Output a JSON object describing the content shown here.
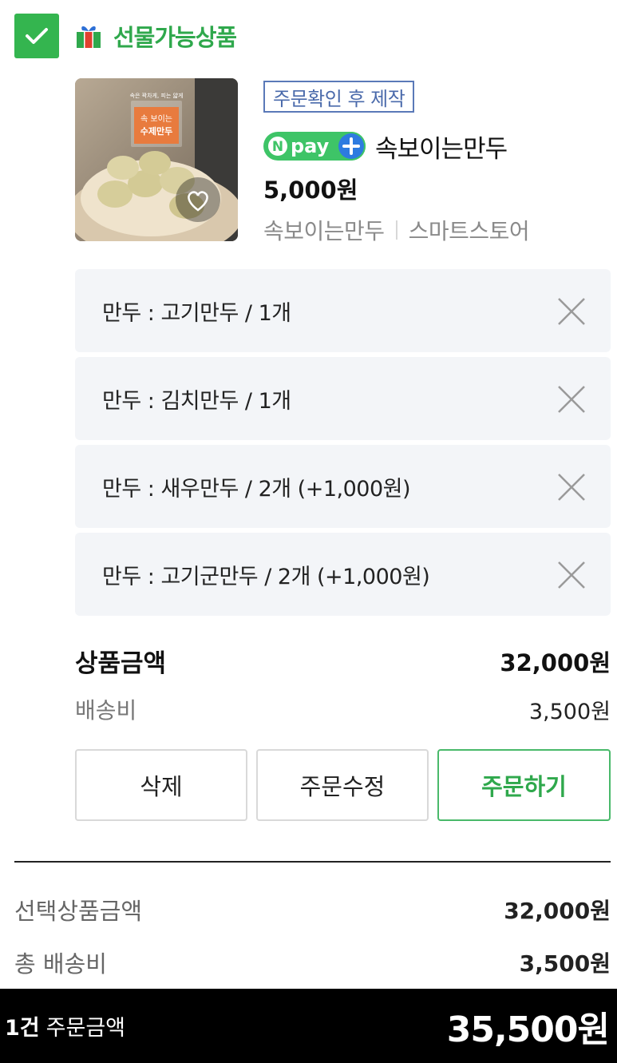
{
  "gift": {
    "checked": true,
    "label": "선물가능상품",
    "accent_color": "#2fa84c"
  },
  "product": {
    "thumbnail": {
      "badge_line1": "속 보이는",
      "badge_line2": "수제만두",
      "small_caption": "속은 꽉차게, 피는 얇게"
    },
    "tag": "주문확인 후 제작",
    "npay_label": "pay",
    "name": "속보이는만두",
    "price": "5,000원",
    "seller": "속보이는만두",
    "store_type": "스마트스토어"
  },
  "options": [
    {
      "text": "만두 : 고기만두 / 1개"
    },
    {
      "text": "만두 : 김치만두 / 1개"
    },
    {
      "text": "만두 : 새우만두 / 2개 (+1,000원)"
    },
    {
      "text": "만두 : 고기군만두 / 2개 (+1,000원)"
    }
  ],
  "summary": {
    "product_amount_label": "상품금액",
    "product_amount_value": "32,000원",
    "shipping_label": "배송비",
    "shipping_value": "3,500원"
  },
  "actions": {
    "delete": "삭제",
    "edit_order": "주문수정",
    "order": "주문하기"
  },
  "totals": {
    "selected_label": "선택상품금액",
    "selected_value": "32,000원",
    "shipping_label": "총 배송비",
    "shipping_value": "3,500원"
  },
  "footer": {
    "count": "1건",
    "label": "주문금액",
    "total": "35,500원"
  }
}
